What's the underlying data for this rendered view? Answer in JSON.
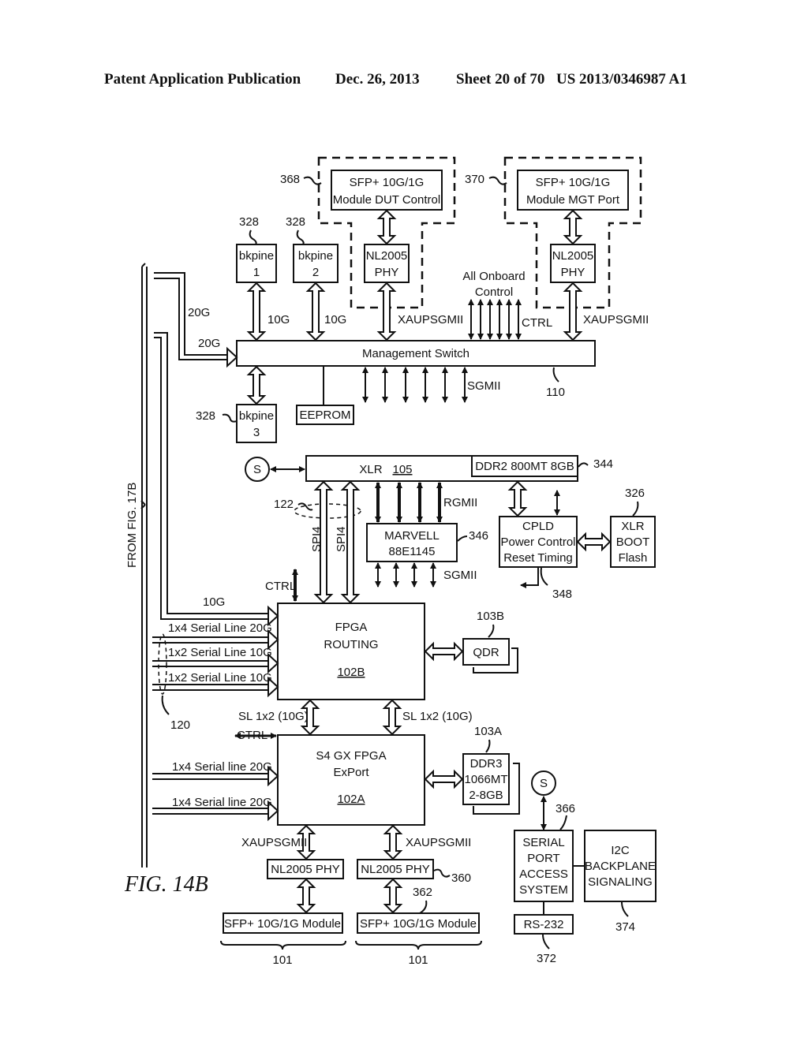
{
  "header": {
    "publication": "Patent Application Publication",
    "date": "Dec. 26, 2013",
    "sheet": "Sheet 20 of 70",
    "number": "US 2013/0346987 A1"
  },
  "figure_label": "FIG. 14B",
  "from_label": "FROM FIG. 17B",
  "blocks": {
    "sfp_dut": [
      "SFP+ 10G/1G",
      "Module DUT Control"
    ],
    "sfp_mgt": [
      "SFP+ 10G/1G",
      "Module MGT Port"
    ],
    "phy_dut": [
      "NL2005",
      "PHY"
    ],
    "phy_mgt": [
      "NL2005",
      "PHY"
    ],
    "bkpine1": [
      "bkpine",
      "1"
    ],
    "bkpine2": [
      "bkpine",
      "2"
    ],
    "bkpine3": [
      "bkpine",
      "3"
    ],
    "mgmt_switch": "Management Switch",
    "eeprom": "EEPROM",
    "xlr": "XLR",
    "xlr_ref": "105",
    "ddr2": "DDR2 800MT 8GB",
    "marvell": [
      "MARVELL",
      "88E1145"
    ],
    "cpld": [
      "CPLD",
      "Power Control",
      "Reset Timing"
    ],
    "xlr_boot": [
      "XLR",
      "BOOT",
      "Flash"
    ],
    "fpga_routing": [
      "FPGA",
      "ROUTING"
    ],
    "fpga_routing_ref": "102B",
    "qdr": "QDR",
    "fpga_export": [
      "S4 GX FPGA",
      "ExPort"
    ],
    "fpga_export_ref": "102A",
    "ddr3": [
      "DDR3",
      "1066MT",
      "2-8GB"
    ],
    "phy_left": "NL2005 PHY",
    "phy_right": "NL2005 PHY",
    "sfp_left": "SFP+ 10G/1G Module",
    "sfp_right": "SFP+ 10G/1G Module",
    "serial": [
      "SERIAL",
      "PORT",
      "ACCESS",
      "SYSTEM"
    ],
    "i2c": [
      "I2C",
      "BACKPLANE",
      "SIGNALING"
    ],
    "rs232": "RS-232",
    "s_node": "S"
  },
  "labels": {
    "all_onboard": [
      "All Onboard",
      "Control"
    ],
    "ctrl": "CTRL",
    "xaupsgmii": "XAUPSGMII",
    "g10": "10G",
    "g20": "20G",
    "sgmii": "SGMII",
    "rgmii": "RGMII",
    "spi4": "SPI4",
    "serial_1x4": "1x4 Serial Line 20G",
    "serial_1x2": "1x2 Serial Line 10G",
    "serial_line_1x4": "1x4 Serial line 20G",
    "sl_1x2": "SL 1x2 (10G)"
  },
  "refs": {
    "r368": "368",
    "r370": "370",
    "r328": "328",
    "r110": "110",
    "r344": "344",
    "r122": "122",
    "r346": "346",
    "r326": "326",
    "r348": "348",
    "r103b": "103B",
    "r103a": "103A",
    "r120": "120",
    "r366": "366",
    "r360": "360",
    "r362": "362",
    "r101": "101",
    "r372": "372",
    "r374": "374"
  }
}
